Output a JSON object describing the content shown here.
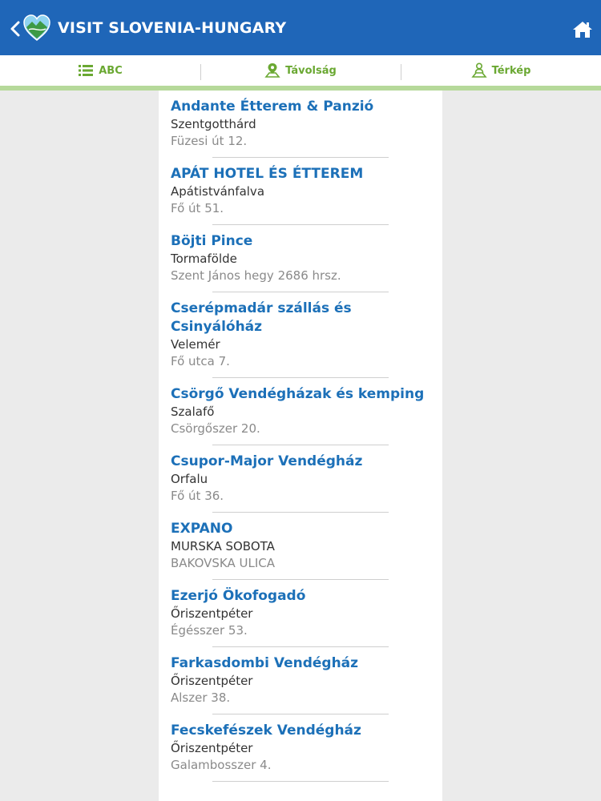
{
  "header": {
    "title": "VISIT SLOVENIA-HUNGARY"
  },
  "tabs": [
    {
      "label": "ABC",
      "icon": "list-icon"
    },
    {
      "label": "Távolság",
      "icon": "map-pin-distance-icon"
    },
    {
      "label": "Térkép",
      "icon": "map-person-icon"
    }
  ],
  "colors": {
    "header_bg": "#1f66b8",
    "tab_text": "#6aa832",
    "item_title": "#1c70b8"
  },
  "items": [
    {
      "name": "Andante Étterem & Panzió",
      "city": "Szentgotthárd",
      "address": "Füzesi út 12."
    },
    {
      "name": "APÁT HOTEL ÉS ÉTTEREM",
      "city": "Apátistvánfalva",
      "address": "Fő út 51."
    },
    {
      "name": "Böjti Pince",
      "city": "Tormafölde",
      "address": "Szent János hegy 2686 hrsz."
    },
    {
      "name": "Cserépmadár szállás és Csinyálóház",
      "city": "Velemér",
      "address": "Fő utca 7."
    },
    {
      "name": "Csörgő Vendégházak és kemping",
      "city": "Szalafő",
      "address": "Csörgőszer 20."
    },
    {
      "name": "Csupor-Major Vendégház",
      "city": "Orfalu",
      "address": "Fő út 36."
    },
    {
      "name": "EXPANO",
      "city": "MURSKA SOBOTA",
      "address": "BAKOVSKA ULICA"
    },
    {
      "name": "Ezerjó Ökofogadó",
      "city": "Őriszentpéter",
      "address": "Égésszer 53."
    },
    {
      "name": "Farkasdombi Vendégház",
      "city": "Őriszentpéter",
      "address": "Alszer 38."
    },
    {
      "name": "Fecskefészek Vendégház",
      "city": "Őriszentpéter",
      "address": "Galambosszer 4."
    }
  ]
}
